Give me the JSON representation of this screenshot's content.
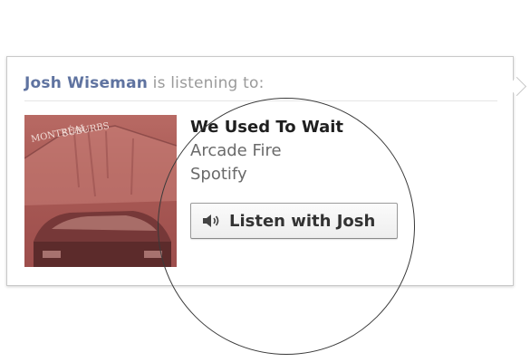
{
  "popup": {
    "user_name": "Josh Wiseman",
    "status_text": " is listening to:"
  },
  "track": {
    "title": "We Used To Wait",
    "artist": "Arcade Fire",
    "service": "Spotify"
  },
  "album_art": {
    "cover_text": "MONTRÉAL\nDE SUBURBS",
    "tint_color": "#a95a55"
  },
  "listen_button": {
    "label": "Listen with Josh",
    "icon": "speaker-icon"
  },
  "colors": {
    "link_blue": "#5f73a0",
    "muted_gray": "#9a9a9a",
    "title_dark": "#1f1f1f"
  }
}
